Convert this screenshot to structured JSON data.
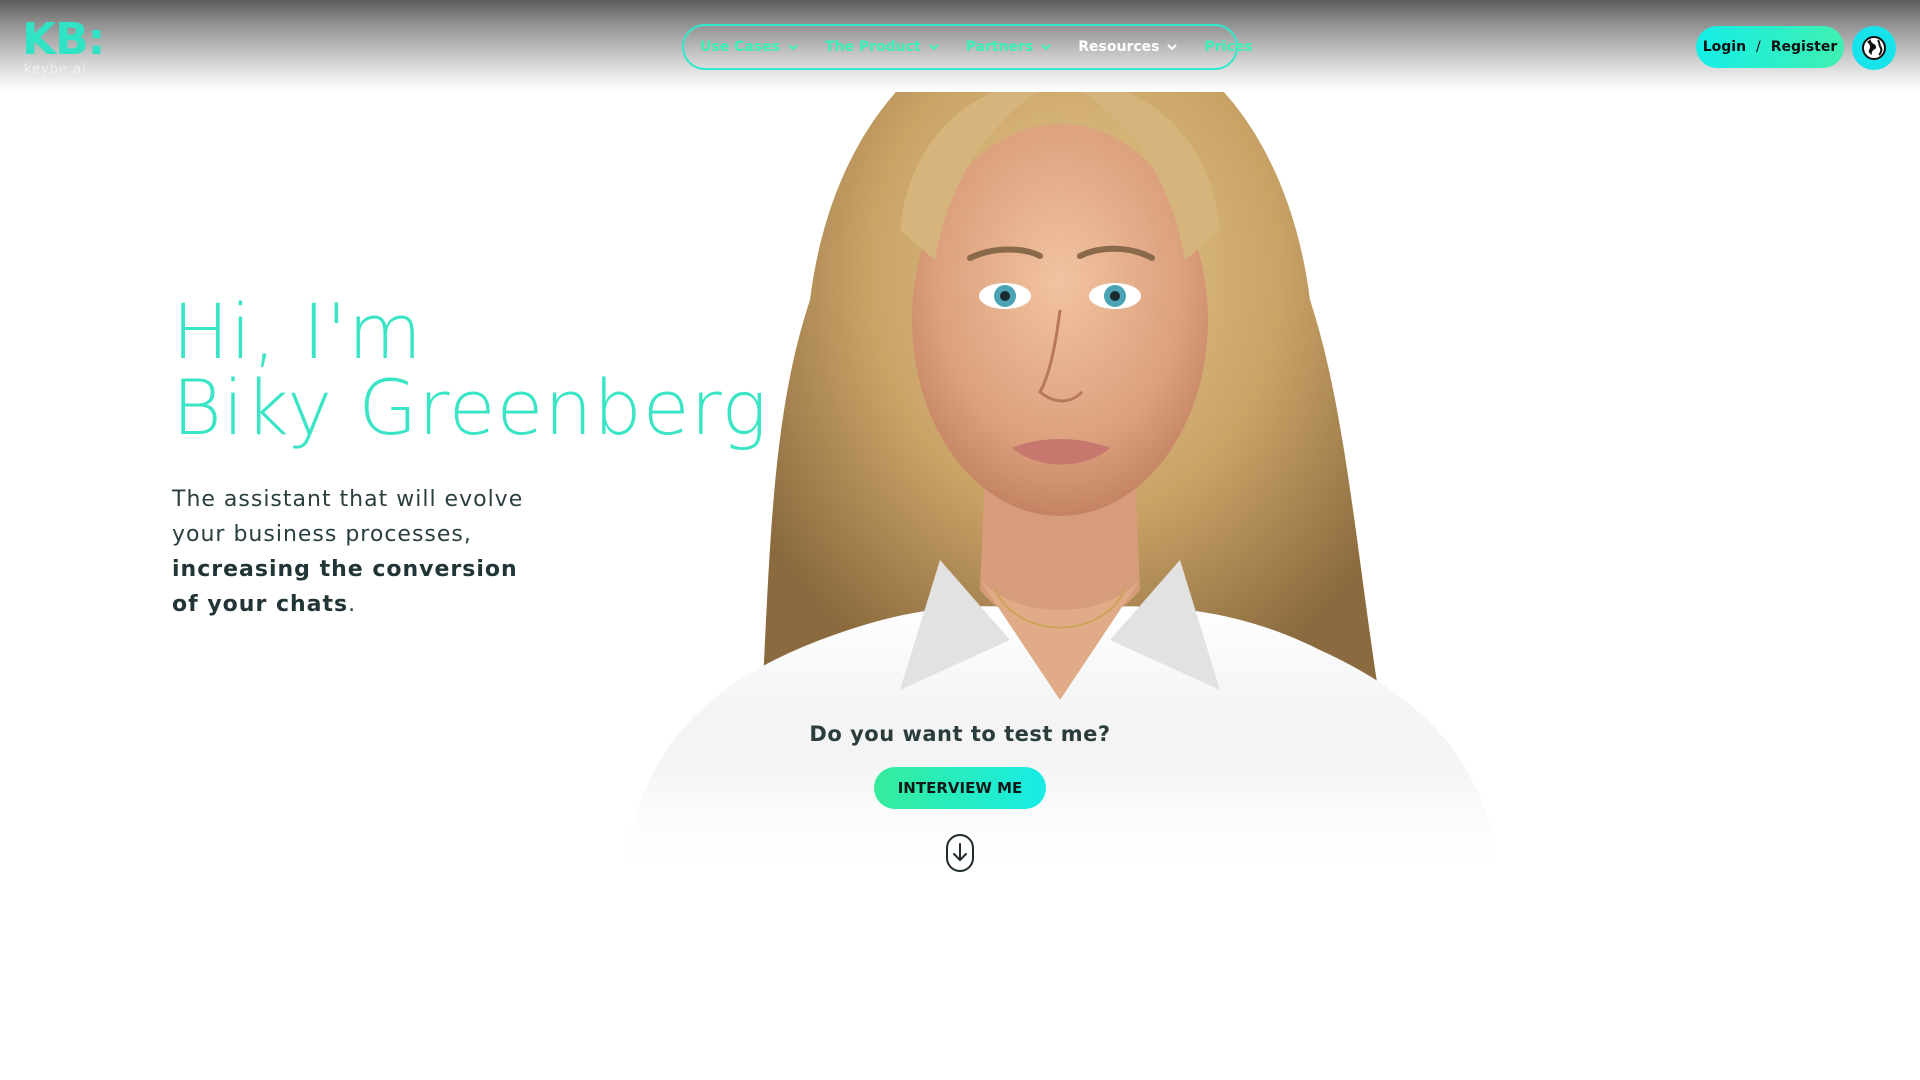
{
  "brand": {
    "logo_mark": "KB:",
    "logo_sub": "keybe.ai",
    "accent": "#31e9cf"
  },
  "nav": {
    "items": [
      {
        "label": "Use Cases",
        "dropdown": true,
        "active": false
      },
      {
        "label": "The Product",
        "dropdown": true,
        "active": false
      },
      {
        "label": "Partners",
        "dropdown": true,
        "active": false
      },
      {
        "label": "Resources",
        "dropdown": true,
        "active": true
      },
      {
        "label": "Prices",
        "dropdown": false,
        "active": false
      }
    ]
  },
  "auth": {
    "login_label": "Login",
    "separator": "/",
    "register_label": "Register"
  },
  "language": {
    "icon": "globe-icon"
  },
  "hero": {
    "title_line1": "Hi, I'm",
    "title_line2": "Biky Greenberg",
    "desc_line1": "The assistant that will evolve",
    "desc_line2": "your business processes,",
    "desc_bold1": "increasing the conversion",
    "desc_bold2": "of your chats",
    "desc_end": "."
  },
  "cta": {
    "question": "Do you want to test me?",
    "button_label": "INTERVIEW ME",
    "scroll_icon": "scroll-down-icon"
  },
  "colors": {
    "title": "#3ae5c6",
    "button_gradient_start": "#35ec9a",
    "button_gradient_end": "#17ece6",
    "text": "#2a3f40"
  }
}
